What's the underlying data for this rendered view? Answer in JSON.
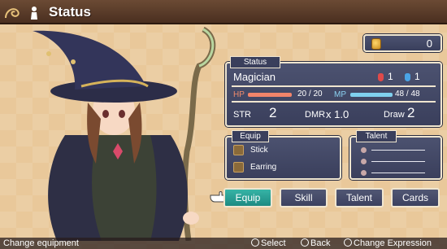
{
  "header": {
    "title": "Status",
    "menu_icon": "swirl-ornament-icon",
    "person_icon": "person-icon"
  },
  "gold": {
    "icon": "gold-coin-icon",
    "value": "0"
  },
  "status": {
    "tab": "Status",
    "class_name": "Magician",
    "red_potion_count": "1",
    "blue_potion_count": "1",
    "hp_label": "HP",
    "hp_text": "20 /  20",
    "hp_fraction": 1.0,
    "mp_label": "MP",
    "mp_text": "48 /  48",
    "mp_fraction": 1.0,
    "str_label": "STR",
    "str_value": "2",
    "dmr_label": "DMR",
    "dmr_value": "x 1.0",
    "draw_label": "Draw",
    "draw_value": "2"
  },
  "equip": {
    "tab": "Equip",
    "items": [
      {
        "name": "Stick",
        "icon": "stick-icon"
      },
      {
        "name": "Earring",
        "icon": "earring-icon"
      }
    ]
  },
  "talent": {
    "tab": "Talent",
    "slots": 3
  },
  "buttons": {
    "equip": "Equip",
    "skill": "Skill",
    "talent": "Talent",
    "cards": "Cards",
    "active": "equip"
  },
  "footer": {
    "hint": "Change equipment",
    "select": "Select",
    "back": "Back",
    "change_expression": "Change Expression"
  },
  "colors": {
    "panel": "#3f4563",
    "border": "#f0e6d0",
    "active_button": "#2aa093",
    "hp": "#f2846a",
    "mp": "#7fd0ee"
  }
}
